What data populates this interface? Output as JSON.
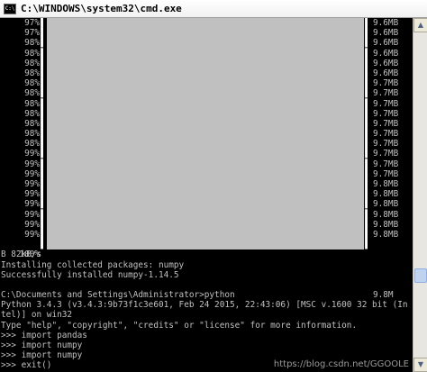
{
  "window": {
    "title": "C:\\WINDOWS\\system32\\cmd.exe",
    "icon_text": "C:\\"
  },
  "progress_rows": [
    {
      "pct": "97%",
      "size": "9.6MB"
    },
    {
      "pct": "97%",
      "size": "9.6MB"
    },
    {
      "pct": "98%",
      "size": "9.6MB"
    },
    {
      "pct": "98%",
      "size": "9.6MB"
    },
    {
      "pct": "98%",
      "size": "9.6MB"
    },
    {
      "pct": "98%",
      "size": "9.6MB"
    },
    {
      "pct": "98%",
      "size": "9.7MB"
    },
    {
      "pct": "98%",
      "size": "9.7MB"
    },
    {
      "pct": "98%",
      "size": "9.7MB"
    },
    {
      "pct": "98%",
      "size": "9.7MB"
    },
    {
      "pct": "98%",
      "size": "9.7MB"
    },
    {
      "pct": "98%",
      "size": "9.7MB"
    },
    {
      "pct": "98%",
      "size": "9.7MB"
    },
    {
      "pct": "99%",
      "size": "9.7MB"
    },
    {
      "pct": "99%",
      "size": "9.7MB"
    },
    {
      "pct": "99%",
      "size": "9.7MB"
    },
    {
      "pct": "99%",
      "size": "9.8MB"
    },
    {
      "pct": "99%",
      "size": "9.8MB"
    },
    {
      "pct": "99%",
      "size": "9.8MB"
    },
    {
      "pct": "99%",
      "size": "9.8MB"
    },
    {
      "pct": "99%",
      "size": "9.8MB"
    },
    {
      "pct": "99%",
      "size": "9.8MB"
    }
  ],
  "final_row": {
    "pct": "100%",
    "size": "9.8M"
  },
  "bar_char": "▌",
  "output_lines": [
    "B 82kB/s",
    "Installing collected packages: numpy",
    "Successfully installed numpy-1.14.5",
    "",
    "C:\\Documents and Settings\\Administrator>python",
    "Python 3.4.3 (v3.4.3:9b73f1c3e601, Feb 24 2015, 22:43:06) [MSC v.1600 32 bit (In",
    "tel)] on win32",
    "Type \"help\", \"copyright\", \"credits\" or \"license\" for more information.",
    ">>> import pandas",
    ">>> import numpy",
    ">>> import numpy",
    ">>> exit()"
  ],
  "watermark": "https://blog.csdn.net/GGOOLE",
  "scrollbar": {
    "up": "▲",
    "down": "▼",
    "position": 0.8
  }
}
